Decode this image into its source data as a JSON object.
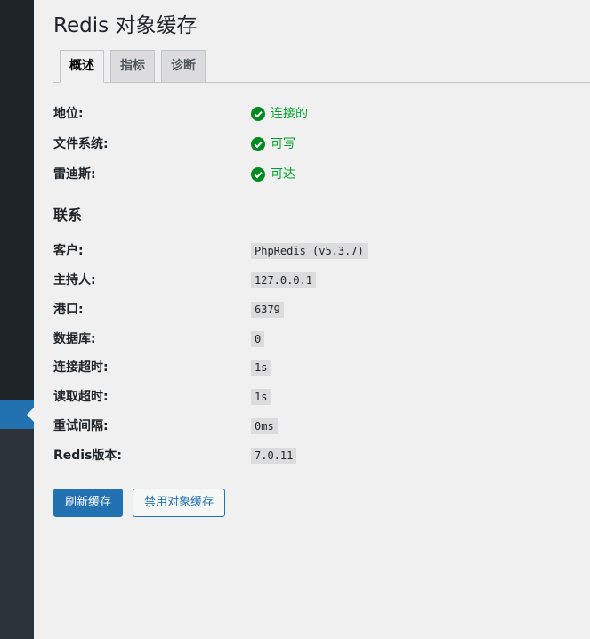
{
  "page": {
    "title": "Redis 对象缓存"
  },
  "tabs": [
    {
      "label": "概述"
    },
    {
      "label": "指标"
    },
    {
      "label": "诊断"
    }
  ],
  "status": [
    {
      "label": "地位:",
      "value": "连接的",
      "icon": "check-circle-icon"
    },
    {
      "label": "文件系统:",
      "value": "可写",
      "icon": "check-circle-icon"
    },
    {
      "label": "雷迪斯:",
      "value": "可达",
      "icon": "check-circle-icon"
    }
  ],
  "connection": {
    "title": "联系",
    "rows": [
      {
        "label": "客户:",
        "value": "PhpRedis (v5.3.7)"
      },
      {
        "label": "主持人:",
        "value": "127.0.0.1"
      },
      {
        "label": "港口:",
        "value": "6379"
      },
      {
        "label": "数据库:",
        "value": "0"
      },
      {
        "label": "连接超时:",
        "value": "1s"
      },
      {
        "label": "读取超时:",
        "value": "1s"
      },
      {
        "label": "重试间隔:",
        "value": "0ms"
      },
      {
        "label": "Redis版本:",
        "value": "7.0.11"
      }
    ]
  },
  "buttons": {
    "flush": "刷新缓存",
    "disable": "禁用对象缓存"
  },
  "colors": {
    "accent": "#2271b1",
    "success": "#00a32a",
    "sidebar": "#1d2327"
  }
}
